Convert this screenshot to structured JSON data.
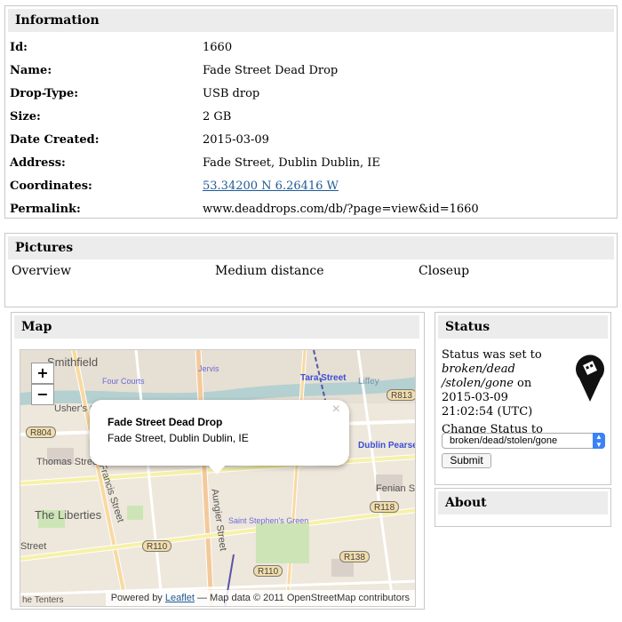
{
  "information": {
    "heading": "Information",
    "rows": [
      {
        "label": "Id:",
        "value": "1660"
      },
      {
        "label": "Name:",
        "value": "Fade Street Dead Drop"
      },
      {
        "label": "Drop-Type:",
        "value": "USB drop"
      },
      {
        "label": "Size:",
        "value": "2 GB"
      },
      {
        "label": "Date Created:",
        "value": "2015-03-09"
      },
      {
        "label": "Address:",
        "value": "Fade Street, Dublin Dublin, IE"
      },
      {
        "label": "Coordinates:",
        "value": "53.34200 N 6.26416 W"
      },
      {
        "label": "Permalink:",
        "value": "www.deaddrops.com/db/?page=view&id=1660"
      }
    ]
  },
  "pictures": {
    "heading": "Pictures",
    "items": [
      "Overview",
      "Medium distance",
      "Closeup"
    ]
  },
  "map": {
    "heading": "Map",
    "zoom_in": "+",
    "zoom_out": "−",
    "popup_title": "Fade Street Dead Drop",
    "popup_address": "Fade Street, Dublin Dublin, IE",
    "popup_close": "×",
    "attribution_prefix": "Powered by",
    "attribution_link": "Leaflet",
    "attribution_suffix": "— Map data © 2011 OpenStreetMap contributors",
    "labels": {
      "smithfield": "Smithfield",
      "four_courts": "Four Courts",
      "tara_street": "Tara Street",
      "ushers_quay": "Usher's Quay",
      "thomas_street": "Thomas Street",
      "the_liberties": "The Liberties",
      "francis_street": "Francis Street",
      "aungier_street": "Aungier Street",
      "st_stephens_green": "Saint Stephen's Green",
      "fenian_street": "Fenian Street",
      "dublin_pearse": "Dublin Pearse",
      "the_tenters": "he Tenters",
      "street": "Street",
      "jervis": "Jervis",
      "liffey": "Liffey"
    },
    "roads": {
      "r804": "R804",
      "r813": "R813",
      "r118": "R118",
      "r110a": "R110",
      "r110b": "R110",
      "r138": "R138"
    }
  },
  "status": {
    "heading": "Status",
    "line1": "Status was set to",
    "status_value": "broken/dead /stolen/gone",
    "line_on": " on",
    "timestamp": "2015-03-09 21:02:54 (UTC)",
    "change_label": "Change Status to",
    "selected_option": "broken/dead/stolen/gone",
    "submit_label": "Submit"
  },
  "about": {
    "heading": "About"
  },
  "colors": {
    "link": "#1f5a96",
    "header_bg": "#ececec",
    "select_accent": "#3b82f6"
  }
}
